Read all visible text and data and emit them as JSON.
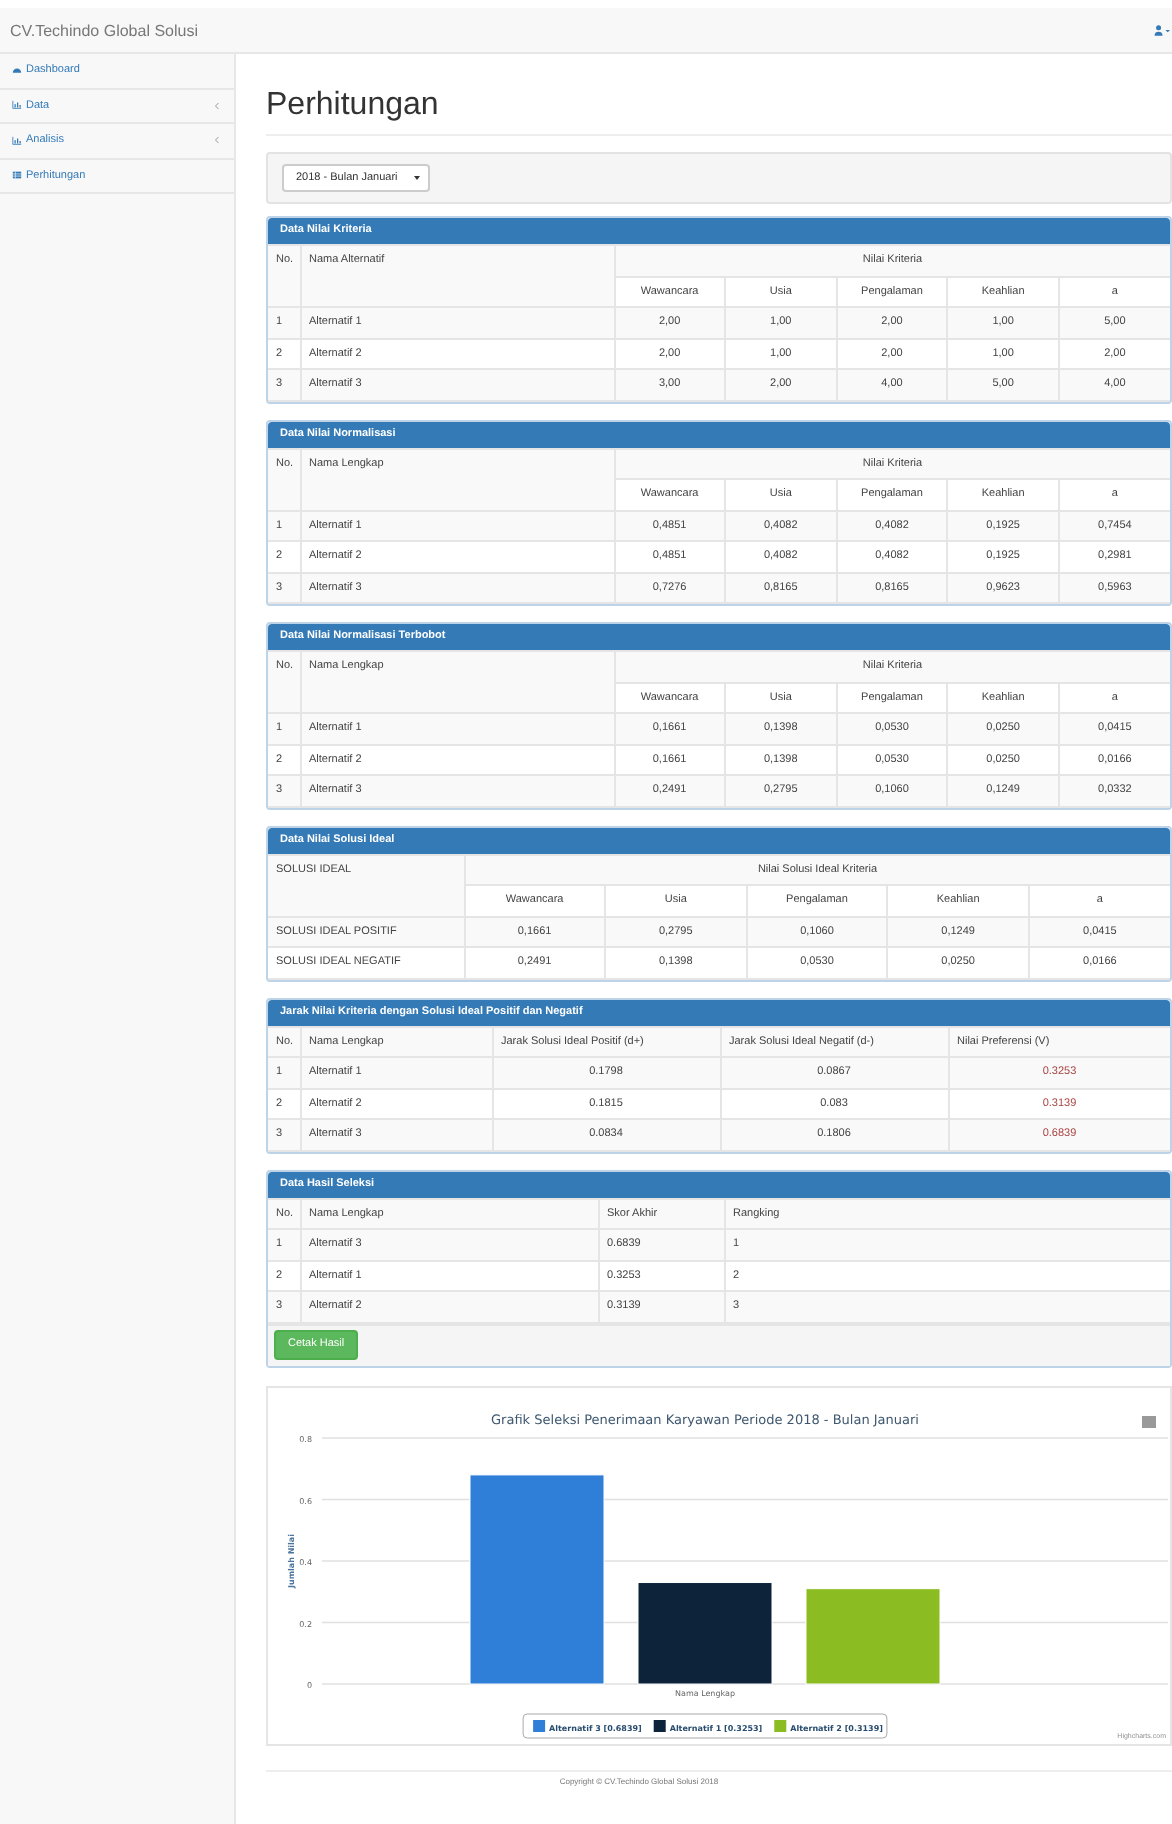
{
  "navbar": {
    "brand": "CV.Techindo Global Solusi"
  },
  "sidebar": {
    "items": [
      {
        "label": "Dashboard",
        "kind": "dashboard",
        "expandable": false
      },
      {
        "label": "Data",
        "kind": "chart",
        "expandable": true
      },
      {
        "label": "Analisis",
        "kind": "chart",
        "expandable": true
      },
      {
        "label": "Perhitungan",
        "kind": "table",
        "expandable": false
      }
    ]
  },
  "page_title": "Perhitungan",
  "period_select": {
    "value": "2018 - Bulan Januari"
  },
  "panels": [
    {
      "kind": "kriteria",
      "title": "Data Nilai Kriteria",
      "head": [
        "No.",
        "Nama Alternatif"
      ],
      "group": "Nilai Kriteria",
      "subhead": [
        "Wawancara",
        "Usia",
        "Pengalaman",
        "Keahlian",
        "a"
      ],
      "rows": [
        [
          "1",
          "Alternatif 1",
          "2,00",
          "1,00",
          "2,00",
          "1,00",
          "5,00"
        ],
        [
          "2",
          "Alternatif 2",
          "2,00",
          "1,00",
          "2,00",
          "1,00",
          "2,00"
        ],
        [
          "3",
          "Alternatif 3",
          "3,00",
          "2,00",
          "4,00",
          "5,00",
          "4,00"
        ]
      ]
    },
    {
      "kind": "kriteria",
      "title": "Data Nilai Normalisasi",
      "head": [
        "No.",
        "Nama Lengkap"
      ],
      "group": "Nilai Kriteria",
      "subhead": [
        "Wawancara",
        "Usia",
        "Pengalaman",
        "Keahlian",
        "a"
      ],
      "rows": [
        [
          "1",
          "Alternatif 1",
          "0,4851",
          "0,4082",
          "0,4082",
          "0,1925",
          "0,7454"
        ],
        [
          "2",
          "Alternatif 2",
          "0,4851",
          "0,4082",
          "0,4082",
          "0,1925",
          "0,2981"
        ],
        [
          "3",
          "Alternatif 3",
          "0,7276",
          "0,8165",
          "0,8165",
          "0,9623",
          "0,5963"
        ]
      ]
    },
    {
      "kind": "kriteria",
      "title": "Data Nilai Normalisasi Terbobot",
      "head": [
        "No.",
        "Nama Lengkap"
      ],
      "group": "Nilai Kriteria",
      "subhead": [
        "Wawancara",
        "Usia",
        "Pengalaman",
        "Keahlian",
        "a"
      ],
      "rows": [
        [
          "1",
          "Alternatif 1",
          "0,1661",
          "0,1398",
          "0,0530",
          "0,0250",
          "0,0415"
        ],
        [
          "2",
          "Alternatif 2",
          "0,1661",
          "0,1398",
          "0,0530",
          "0,0250",
          "0,0166"
        ],
        [
          "3",
          "Alternatif 3",
          "0,2491",
          "0,2795",
          "0,1060",
          "0,1249",
          "0,0332"
        ]
      ]
    },
    {
      "kind": "ideal",
      "title": "Data Nilai Solusi Ideal",
      "head": [
        "SOLUSI IDEAL"
      ],
      "group": "Nilai Solusi Ideal Kriteria",
      "subhead": [
        "Wawancara",
        "Usia",
        "Pengalaman",
        "Keahlian",
        "a"
      ],
      "rows": [
        [
          "SOLUSI IDEAL POSITIF",
          "0,1661",
          "0,2795",
          "0,1060",
          "0,1249",
          "0,0415"
        ],
        [
          "SOLUSI IDEAL NEGATIF",
          "0,2491",
          "0,1398",
          "0,0530",
          "0,0250",
          "0,0166"
        ]
      ]
    },
    {
      "kind": "jarak",
      "title": "Jarak Nilai Kriteria dengan Solusi Ideal Positif dan Negatif",
      "head": [
        "No.",
        "Nama Lengkap",
        "Jarak Solusi Ideal Positif (d+)",
        "Jarak Solusi Ideal Negatif (d-)",
        "Nilai Preferensi (V)"
      ],
      "rows": [
        [
          "1",
          "Alternatif 1",
          "0.1798",
          "0.0867",
          "0.3253"
        ],
        [
          "2",
          "Alternatif 2",
          "0.1815",
          "0.083",
          "0.3139"
        ],
        [
          "3",
          "Alternatif 3",
          "0.0834",
          "0.1806",
          "0.6839"
        ]
      ]
    },
    {
      "kind": "hasil",
      "title": "Data Hasil Seleksi",
      "head": [
        "No.",
        "Nama Lengkap",
        "Skor Akhir",
        "Rangking"
      ],
      "rows": [
        [
          "1",
          "Alternatif 3",
          "0.6839",
          "1"
        ],
        [
          "2",
          "Alternatif 1",
          "0.3253",
          "2"
        ],
        [
          "3",
          "Alternatif 2",
          "0.3139",
          "3"
        ]
      ],
      "button": "Cetak Hasil"
    }
  ],
  "chart": {
    "chart_data": {
      "type": "bar",
      "title": "Grafik Seleksi Penerimaan Karyawan Periode 2018 - Bulan Januari",
      "xlabel": "Nama Lengkap",
      "ylabel": "Jumlah Nilai",
      "series": [
        {
          "name": "Alternatif 3 [0.6839]",
          "color": "#2f7ed8",
          "values": [
            0.68
          ]
        },
        {
          "name": "Alternatif 1 [0.3253]",
          "color": "#0d233a",
          "values": [
            0.33
          ]
        },
        {
          "name": "Alternatif 2 [0.3139]",
          "color": "#8bbc21",
          "values": [
            0.31
          ]
        }
      ],
      "ylim": [
        0,
        0.8
      ],
      "yticks": [
        0,
        0.2,
        0.4,
        0.6,
        0.8
      ],
      "grid": true,
      "legend": true
    },
    "credits": "Highcharts.com"
  },
  "footer": "Copyright © CV.Techindo Global Solusi 2018"
}
